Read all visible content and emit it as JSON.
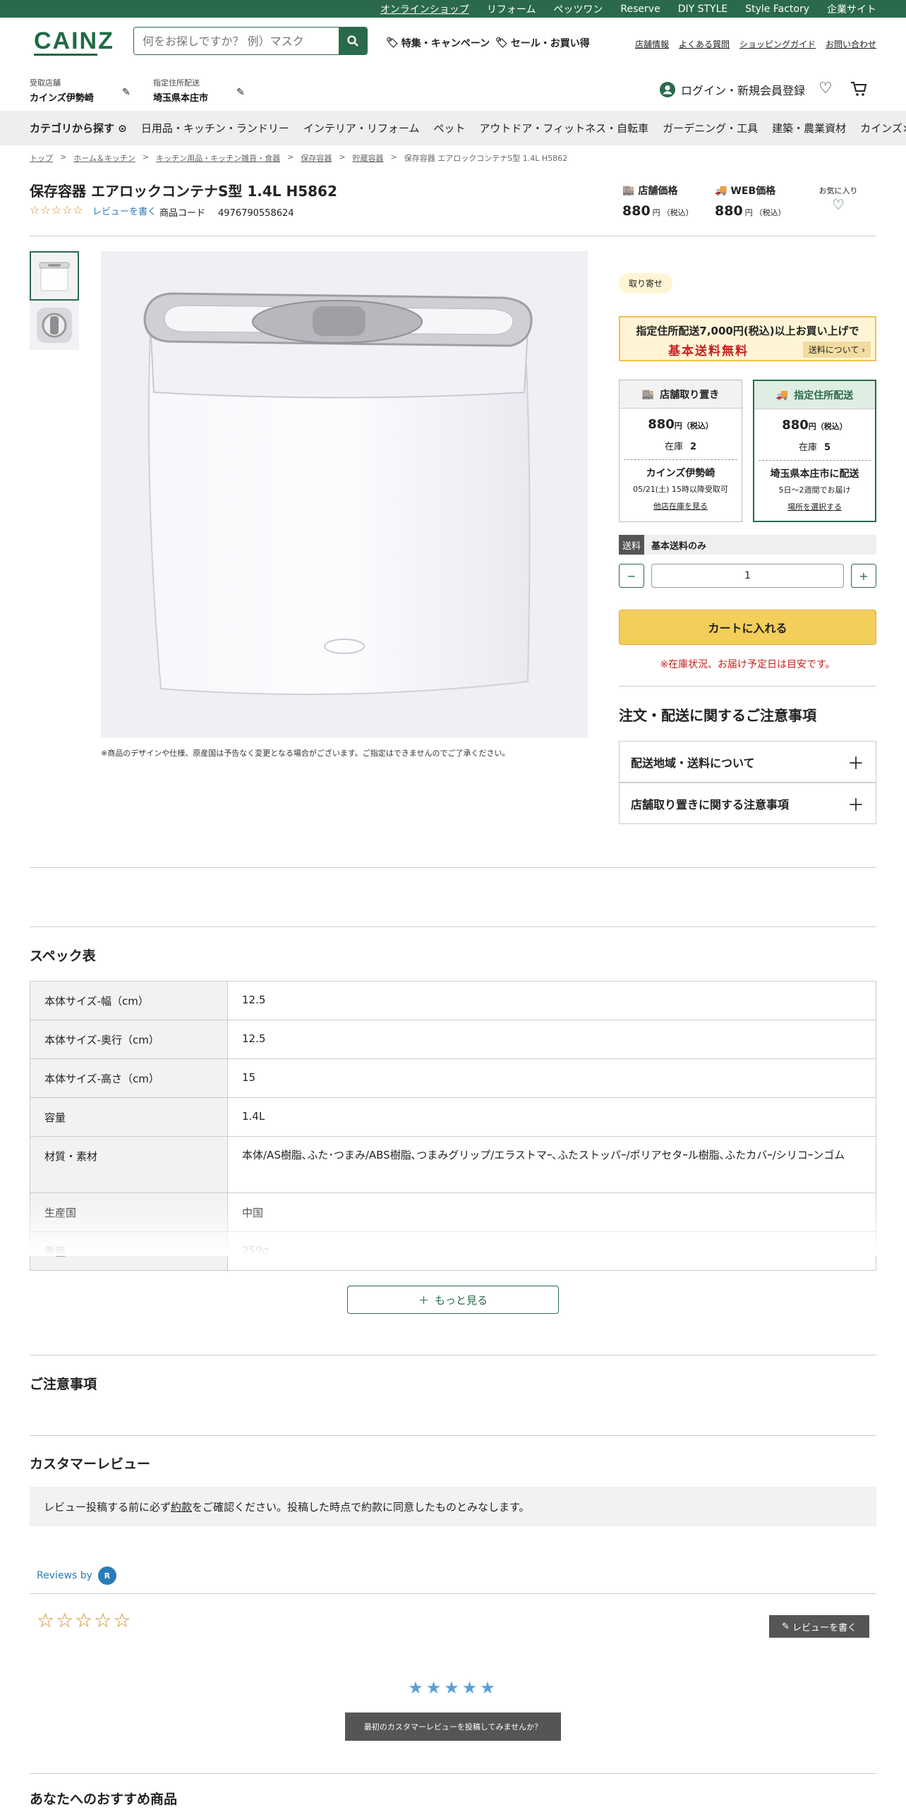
{
  "topbar": {
    "links": [
      "オンラインショップ",
      "リフォーム",
      "ペッツワン",
      "Reserve",
      "DIY STYLE",
      "Style Factory",
      "企業サイト"
    ]
  },
  "header": {
    "logo": "CAINZ",
    "search_placeholder": "何をお探しですか？ 例）マスク",
    "feature_link": "特集・キャンペーン",
    "sale_link": "セール・お買い得",
    "util_links": [
      "店舗情報",
      "よくある質問",
      "ショッピングガイド",
      "お問い合わせ"
    ],
    "pickup_label": "受取店舗",
    "pickup_value": "カインズ伊勢崎",
    "delivery_label": "指定住所配送",
    "delivery_value": "埼玉県本庄市",
    "login": "ログイン・新規会員登録"
  },
  "catnav": {
    "items": [
      "カテゴリから探す",
      "日用品・キッチン・ランドリー",
      "インテリア・リフォーム",
      "ペット",
      "アウトドア・フィットネス・自転車",
      "ガーデニング・工具",
      "建築・農業資材",
      "カインズ×DIY"
    ]
  },
  "breadcrumb": [
    "トップ",
    "ホーム＆キッチン",
    "キッチン用品・キッチン雑貨・食器",
    "保存容器",
    "貯蔵容器",
    "保存容器 エアロックコンテナS型 1.4L H5862"
  ],
  "product": {
    "title": "保存容器 エアロックコンテナS型 1.4L H5862",
    "rating_stars": "☆☆☆☆☆",
    "review_link": "レビューを書く",
    "code_label": "商品コード",
    "code_value": "4976790558624",
    "store_price_label": "店舗価格",
    "store_price": "880",
    "web_price_label": "WEB価格",
    "web_price": "880",
    "yen": "円",
    "tax": "（税込）",
    "favorite": "お気に入り",
    "image_note": "※商品のデザインや仕様、原産国は予告なく変更となる場合がございます。ご指定はできませんのでご了承ください。"
  },
  "purchase": {
    "badge": "取り寄せ",
    "banner_line1": "指定住所配送7,000円(税込)以上お買い上げで",
    "banner_line2": "基本送料無料",
    "banner_link": "送料について",
    "store_card": {
      "title": "店舗取り置き",
      "price": "880",
      "stock_label": "在庫",
      "stock": "2",
      "store": "カインズ伊勢崎",
      "date": "05/21(土) 15時以降受取可",
      "link": "他店在庫を見る"
    },
    "ship_card": {
      "title": "指定住所配送",
      "price": "880",
      "stock_label": "在庫",
      "stock": "5",
      "area": "埼玉県本庄市に配送",
      "date": "5日～2週間でお届け",
      "link": "場所を選択する"
    },
    "postage_tag": "送料",
    "postage_value": "基本送料のみ",
    "qty_minus": "−",
    "qty": "1",
    "qty_plus": "+",
    "cart": "カートに入れる",
    "warning": "※在庫状況、お届け予定日は目安です。",
    "notice_title": "注文・配送に関するご注意事項",
    "acc1": "配送地域・送料について",
    "acc2": "店舗取り置きに関する注意事項"
  },
  "spec": {
    "title": "スペック表",
    "rows": [
      {
        "k": "本体サイズ-幅（cm）",
        "v": "12.5"
      },
      {
        "k": "本体サイズ-奥行（cm）",
        "v": "12.5"
      },
      {
        "k": "本体サイズ-高さ（cm）",
        "v": "15"
      },
      {
        "k": "容量",
        "v": "1.4L"
      },
      {
        "k": "材質・素材",
        "v": "本体/AS樹脂､ふた･つまみ/ABS樹脂､つまみグリップ/エラストマｰ､ふたストッパｰ/ポリアセタｰル樹脂､ふたカバｰ/シリコｰンゴム"
      },
      {
        "k": "生産国",
        "v": "中国"
      },
      {
        "k": "重量",
        "v": "259g"
      }
    ],
    "more": "もっと見る"
  },
  "caution_title": "ご注意事項",
  "reviews": {
    "title": "カスタマーレビュー",
    "note_pre": "レビュー投稿する前に必ず",
    "note_link": "約款",
    "note_post": "をご確認ください。投稿した時点で約款に同意したものとみなします。",
    "by": "Reviews by",
    "by_icon": "R",
    "stars": "☆☆☆☆☆",
    "write": "レビューを書く",
    "blue_stars": "★★★★★",
    "first": "最初のカスタマーレビューを投稿してみませんか？"
  },
  "recommend_title": "あなたへのおすすめ商品",
  "colors": {
    "brand": "#2a6a4b",
    "cart": "#f3ce5a",
    "warn": "#c81e1e",
    "link": "#2b7bb9"
  }
}
